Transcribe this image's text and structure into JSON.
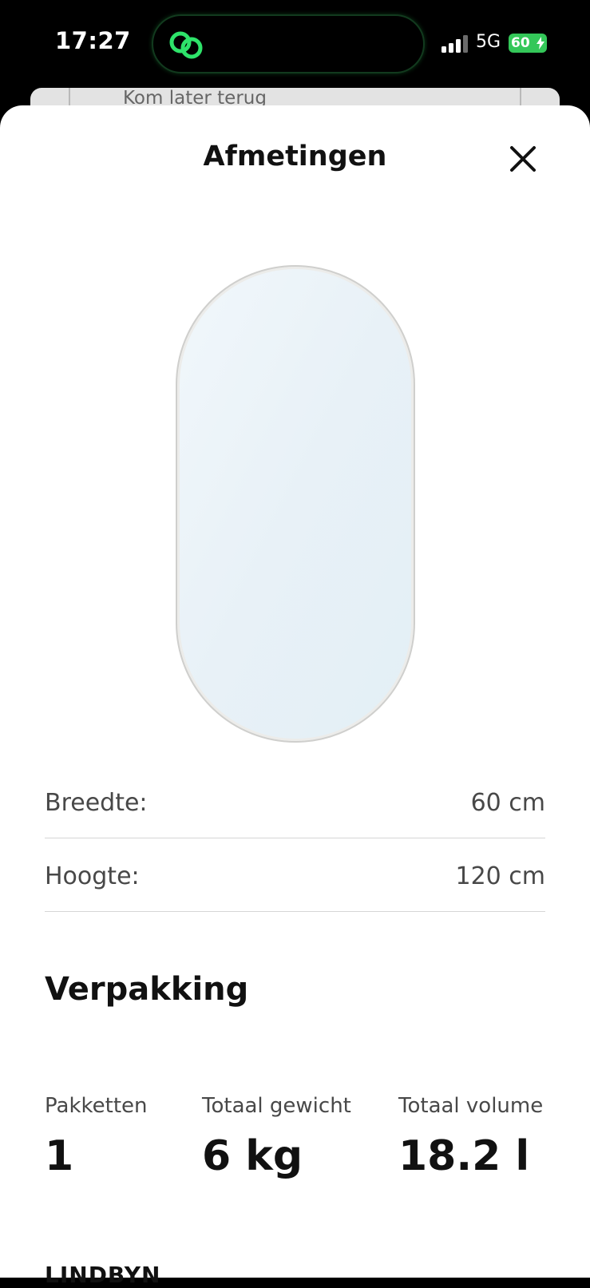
{
  "status_bar": {
    "time": "17:27",
    "network": "5G",
    "battery": "60",
    "accent_green": "#34c759"
  },
  "background_page": {
    "text": "Kom later terug"
  },
  "sheet": {
    "title": "Afmetingen",
    "close_icon": "close-icon",
    "image_icon": "oval-mirror-image",
    "dimensions": [
      {
        "label": "Breedte:",
        "value": "60 cm"
      },
      {
        "label": "Hoogte:",
        "value": "120 cm"
      }
    ],
    "packaging": {
      "title": "Verpakking",
      "stats": [
        {
          "label": "Pakketten",
          "value": "1"
        },
        {
          "label": "Totaal gewicht",
          "value": "6 kg"
        },
        {
          "label": "Totaal volume",
          "value": "18.2 l"
        }
      ]
    },
    "product_name": "LINDBYN"
  }
}
